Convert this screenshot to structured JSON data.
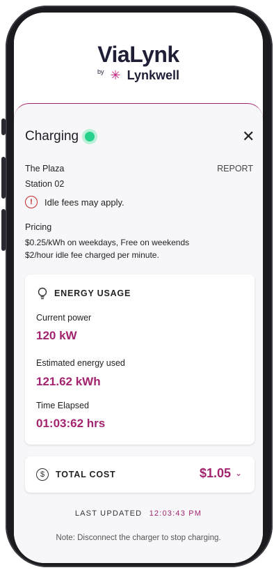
{
  "brand": {
    "name": "ViaLynk",
    "by": "by",
    "sub": "Lynkwell"
  },
  "charging": {
    "title": "Charging",
    "status": "active",
    "status_color": "#26d18b",
    "location_name": "The Plaza",
    "station": "Station 02",
    "report_label": "REPORT",
    "warning": "Idle fees may apply."
  },
  "pricing": {
    "label": "Pricing",
    "line1": "$0.25/kWh on weekdays, Free on weekends",
    "line2": "$2/hour idle fee charged per minute."
  },
  "energy": {
    "heading": "ENERGY USAGE",
    "current_power_label": "Current power",
    "current_power_value": "120 kW",
    "energy_used_label": "Estimated energy used",
    "energy_used_value": "121.62 kWh",
    "time_label": "Time Elapsed",
    "time_value": "01:03:62 hrs"
  },
  "cost": {
    "label": "TOTAL COST",
    "value": "$1.05"
  },
  "updated": {
    "label": "LAST UPDATED",
    "time": "12:03:43 PM"
  },
  "note": "Note: Disconnect the charger to stop charging.",
  "colors": {
    "accent": "#a3246e",
    "brand_dark": "#1e1f36",
    "warning": "#c62828"
  }
}
